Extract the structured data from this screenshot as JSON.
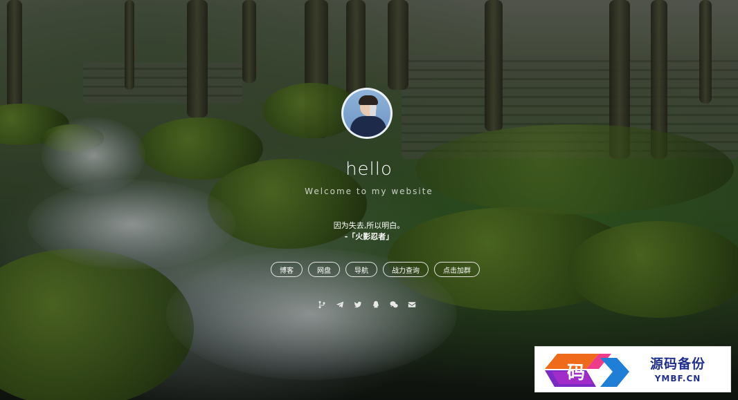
{
  "profile": {
    "title": "hello",
    "subtitle": "Welcome to my website",
    "quote": "因为失去,所以明白。",
    "quote_source": "-「火影忍者」"
  },
  "nav_buttons": [
    {
      "label": "博客"
    },
    {
      "label": "网盘"
    },
    {
      "label": "导航"
    },
    {
      "label": "战力查询"
    },
    {
      "label": "点击加群"
    }
  ],
  "social_icons": [
    "git-branch-icon",
    "telegram-icon",
    "twitter-icon",
    "qq-icon",
    "wechat-icon",
    "mail-icon"
  ],
  "watermark": {
    "logo_char": "码",
    "name": "源码备份",
    "domain": "YMBF.CN"
  },
  "colors": {
    "button_border": "#ffffff",
    "watermark_text": "#1f2f8e"
  }
}
